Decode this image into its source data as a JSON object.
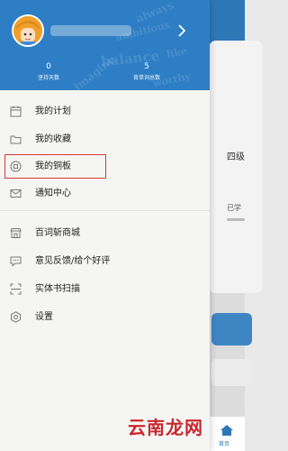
{
  "background": {
    "card_text": "四级",
    "progress_label": "已学",
    "tab_home_label": "首页"
  },
  "header": {
    "username": "",
    "stats": [
      {
        "value": "0",
        "label": "坚持天数"
      },
      {
        "value": "5",
        "label": "背单词总数"
      }
    ],
    "watermark_words": [
      "always",
      "ambitious",
      "balance",
      "like",
      "imagine",
      "worthy"
    ]
  },
  "menu": [
    {
      "label": "我的计划",
      "icon": "calendar-icon"
    },
    {
      "label": "我的收藏",
      "icon": "folder-icon"
    },
    {
      "label": "我的铜板",
      "icon": "coin-icon"
    },
    {
      "label": "通知中心",
      "icon": "mail-icon"
    },
    {
      "label": "百词斩商城",
      "icon": "shop-icon"
    },
    {
      "label": "意见反馈/给个好评",
      "icon": "feedback-icon"
    },
    {
      "label": "实体书扫描",
      "icon": "scan-icon"
    },
    {
      "label": "设置",
      "icon": "gear-icon"
    }
  ],
  "site_watermark": "云南龙网",
  "colors": {
    "header_blue": "#2d7ec4",
    "highlight_red": "#d93a2f",
    "avatar_orange": "#f0a02a"
  }
}
